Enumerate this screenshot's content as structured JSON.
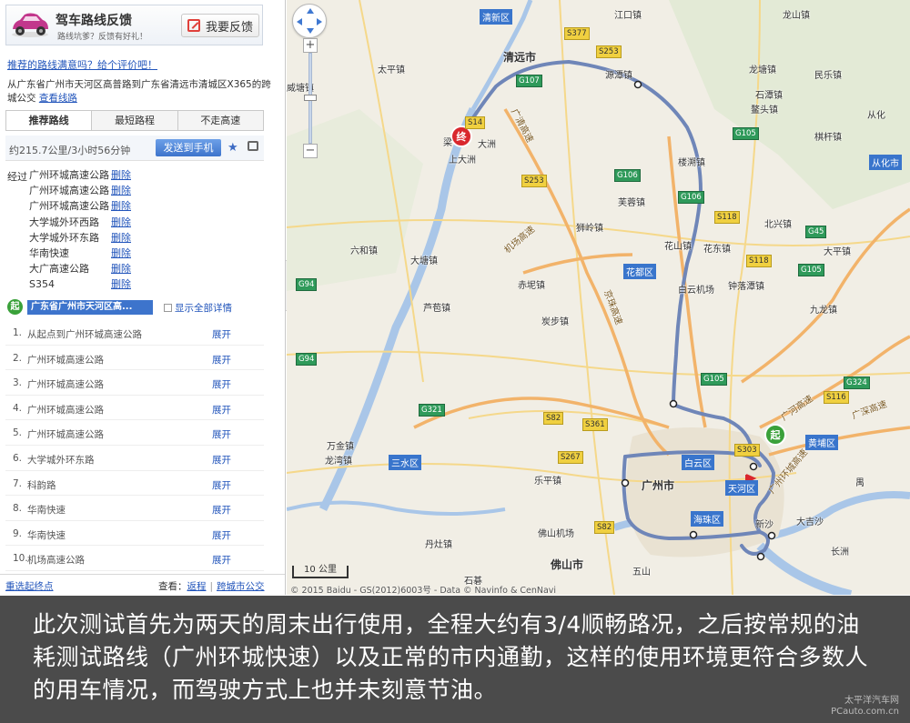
{
  "banner": {
    "title": "驾车路线反馈",
    "subtitle": "路线坑爹？反馈有好礼！",
    "feedback_button": "我要反馈"
  },
  "rate_link": "推荐的路线满意吗？给个评价吧！",
  "route_description": "从广东省广州市天河区高普路到广东省清远市清城区X365的跨城公交",
  "view_route_link": "查看线路",
  "tabs": [
    {
      "label": "推荐路线",
      "active": true
    },
    {
      "label": "最短路程",
      "active": false
    },
    {
      "label": "不走高速",
      "active": false
    }
  ],
  "summary": {
    "distance_time": "约215.7公里/3小时56分钟",
    "send_button": "发送到手机"
  },
  "via_label": "经过",
  "delete_label": "删除",
  "via_roads": [
    "广州环城高速公路",
    "广州环城高速公路",
    "广州环城高速公路",
    "大学城外环西路",
    "大学城外环东路",
    "华南快速",
    "大广高速公路",
    "S354"
  ],
  "start": {
    "badge": "起",
    "label": "广东省广州市天河区高...",
    "show_all": "显示全部详情"
  },
  "expand_label": "展开",
  "steps": [
    {
      "num": "1.",
      "text": "从起点到广州环城高速公路"
    },
    {
      "num": "2.",
      "text": "广州环城高速公路"
    },
    {
      "num": "3.",
      "text": "广州环城高速公路"
    },
    {
      "num": "4.",
      "text": "广州环城高速公路"
    },
    {
      "num": "5.",
      "text": "广州环城高速公路"
    },
    {
      "num": "6.",
      "text": "大学城外环东路"
    },
    {
      "num": "7.",
      "text": "科韵路"
    },
    {
      "num": "8.",
      "text": "华南快速"
    },
    {
      "num": "9.",
      "text": "华南快速"
    },
    {
      "num": "10.",
      "text": "机场高速公路"
    }
  ],
  "footer": {
    "reselect": "重选起终点",
    "view_label": "查看：",
    "return_link": "返程",
    "cross_city_bus": "跨城市公交"
  },
  "map": {
    "labels": [
      {
        "text": "清新区",
        "kind": "box"
      },
      {
        "text": "清远市",
        "kind": "city"
      },
      {
        "text": "花都区",
        "kind": "box"
      },
      {
        "text": "白云区",
        "kind": "box"
      },
      {
        "text": "天河区",
        "kind": "box"
      },
      {
        "text": "海珠区",
        "kind": "box"
      },
      {
        "text": "黄埔区",
        "kind": "box"
      },
      {
        "text": "三水区",
        "kind": "box"
      },
      {
        "text": "广州市",
        "kind": "city"
      },
      {
        "text": "佛山市",
        "kind": "city"
      },
      {
        "text": "从化市",
        "kind": "box"
      },
      {
        "text": "龙山镇"
      },
      {
        "text": "江口镇"
      },
      {
        "text": "太平镇"
      },
      {
        "text": "源潭镇"
      },
      {
        "text": "龙塘镇"
      },
      {
        "text": "石潭镇"
      },
      {
        "text": "鳌头镇"
      },
      {
        "text": "民乐镇"
      },
      {
        "text": "从化"
      },
      {
        "text": "楼溯镇"
      },
      {
        "text": "棋杆镇"
      },
      {
        "text": "芙蓉镇"
      },
      {
        "text": "北兴镇"
      },
      {
        "text": "花山镇"
      },
      {
        "text": "花东镇"
      },
      {
        "text": "狮岭镇"
      },
      {
        "text": "大平镇"
      },
      {
        "text": "六和镇"
      },
      {
        "text": "大塘镇"
      },
      {
        "text": "赤坭镇"
      },
      {
        "text": "炭步镇"
      },
      {
        "text": "钟落潭镇"
      },
      {
        "text": "九龙镇"
      },
      {
        "text": "芦苞镇"
      },
      {
        "text": "万金镇"
      },
      {
        "text": "龙湾镇"
      },
      {
        "text": "乐平镇"
      },
      {
        "text": "丹灶镇"
      },
      {
        "text": "佛山机场"
      },
      {
        "text": "白云机场"
      },
      {
        "text": "新沙"
      },
      {
        "text": "大吉沙"
      },
      {
        "text": "长洲"
      },
      {
        "text": "威塘镇"
      },
      {
        "text": "上大洲"
      },
      {
        "text": "大洲"
      },
      {
        "text": "梁"
      },
      {
        "text": "五山"
      },
      {
        "text": "石碁"
      },
      {
        "text": "禺"
      }
    ],
    "shields": [
      "S377",
      "S253",
      "G107",
      "S14",
      "G106",
      "S253",
      "G106",
      "G105",
      "G45",
      "S118",
      "G105",
      "G94",
      "S118",
      "G105",
      "S116",
      "G324",
      "G321",
      "S82",
      "S361",
      "S267",
      "S82",
      "G94",
      "S303"
    ],
    "highway_names": [
      "广清高速",
      "京珠高速",
      "机场高速",
      "广河高速",
      "广深高速",
      "广州环城高速"
    ],
    "markers": {
      "start": "起",
      "end": "终"
    },
    "scale_label": "10 公里",
    "copyright": "© 2015 Baidu - GS(2012)6003号 - Data © Navinfo & CenNavi"
  },
  "caption": "此次测试首先为两天的周末出行使用，全程大约有3/4顺畅路况，之后按常规的油耗测试路线（广州环城快速）以及正常的市内通勤，这样的使用环境更符合多数人的用车情况，而驾驶方式上也并未刻意节油。",
  "watermark": {
    "line1": "太平洋汽车网",
    "line2": "PCauto.com.cn"
  },
  "colors": {
    "route": "#6f86b8",
    "link": "#2255bb",
    "highway": "#f2b36a",
    "water": "#a9c6e8",
    "start": "#3aa13a",
    "end": "#d9272d"
  }
}
